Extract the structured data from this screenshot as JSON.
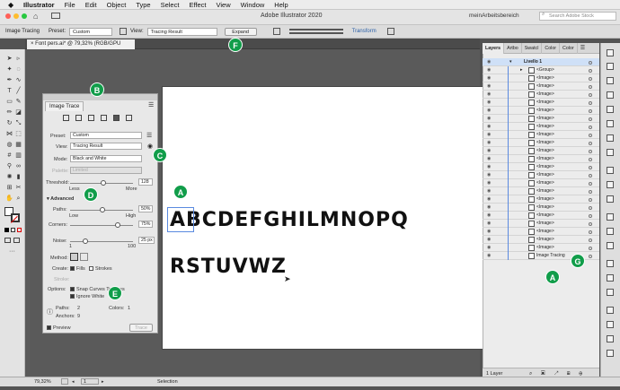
{
  "menubar": {
    "apple": "",
    "items": [
      "Illustrator",
      "File",
      "Edit",
      "Object",
      "Type",
      "Select",
      "Effect",
      "View",
      "Window",
      "Help"
    ]
  },
  "titlebar": {
    "title": "Adobe Illustrator 2020",
    "workspace": "meinArbeitsbereich",
    "search_placeholder": "Search Adobe Stock"
  },
  "controlbar": {
    "label": "Image Tracing",
    "preset_label": "Preset:",
    "preset_value": "Custom",
    "view_label": "View:",
    "view_value": "Tracing Result",
    "expand": "Expand",
    "transform": "Transform"
  },
  "document": {
    "tab": "Font pers.ai* @ 79,32% (RGB/GPU Preview)"
  },
  "artboard": {
    "line1": "ABCDEFGHILMNOPQ",
    "line2": "RSTUVWZ"
  },
  "image_trace": {
    "tab": "Image Trace",
    "preset_label": "Preset:",
    "preset_value": "Custom",
    "view_label": "View:",
    "view_value": "Tracing Result",
    "mode_label": "Mode:",
    "mode_value": "Black and White",
    "palette_label": "Palette:",
    "palette_value": "Limited",
    "threshold_label": "Threshold:",
    "threshold_value": "128",
    "less": "Less",
    "more": "More",
    "advanced": "Advanced",
    "paths_label": "Paths:",
    "paths_value": "50%",
    "low": "Low",
    "high": "High",
    "corners_label": "Corners:",
    "corners_value": "75%",
    "noise_label": "Noise:",
    "noise_value": "25 px",
    "noise_min": "1",
    "noise_max": "100",
    "method_label": "Method:",
    "create_label": "Create:",
    "fills": "Fills",
    "strokes": "Strokes",
    "stroke_label": "Stroke:",
    "options_label": "Options:",
    "snap": "Snap Curves To Lines",
    "ignore_white": "Ignore White",
    "paths_stat_label": "Paths:",
    "paths_stat": "2",
    "colors_stat_label": "Colors:",
    "colors_stat": "1",
    "anchors_stat_label": "Anchors:",
    "anchors_stat": "9",
    "preview": "Preview",
    "trace": "Trace"
  },
  "layers": {
    "tabs": [
      "Layers",
      "Artbo",
      "Swatcl",
      "Color",
      "Color"
    ],
    "rows": [
      "Livello 1",
      "<Group>",
      "<Image>",
      "<Image>",
      "<Image>",
      "<Image>",
      "<Image>",
      "<Image>",
      "<Image>",
      "<Image>",
      "<Image>",
      "<Image>",
      "<Image>",
      "<Image>",
      "<Image>",
      "<Image>",
      "<Image>",
      "<Image>",
      "<Image>",
      "<Image>",
      "<Image>",
      "<Image>",
      "<Image>",
      "<Image>",
      "Image Tracing"
    ],
    "footer": "1 Layer"
  },
  "status": {
    "zoom": "79,32%",
    "artboard": "1",
    "mode": "Selection"
  },
  "badges": {
    "A1": "A",
    "A2": "A",
    "B": "B",
    "C": "C",
    "D": "D",
    "E": "E",
    "F": "F",
    "G": "G"
  },
  "colors": {
    "badge": "#119d4a",
    "selection": "#5a8ae0"
  }
}
